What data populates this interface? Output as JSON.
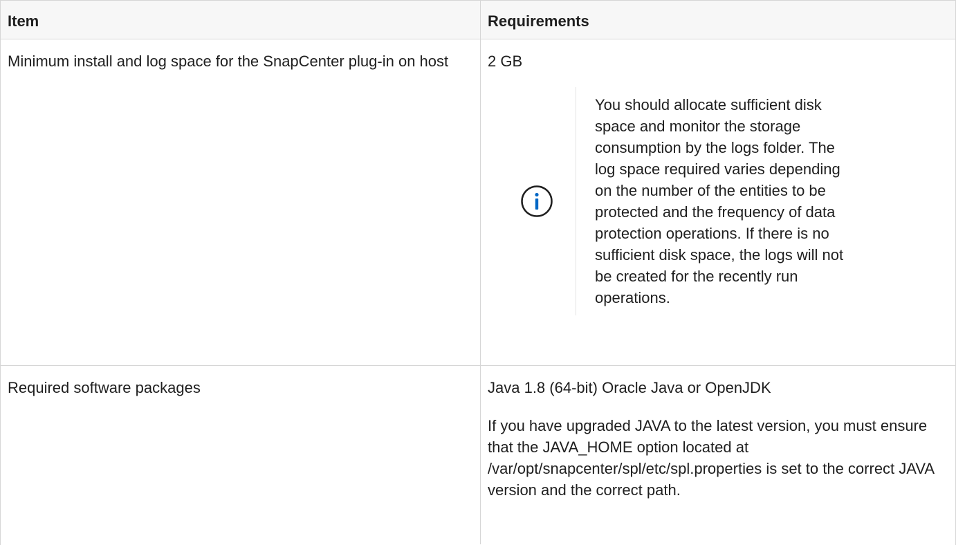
{
  "table": {
    "headers": {
      "item": "Item",
      "requirements": "Requirements"
    },
    "rows": [
      {
        "item": "Minimum install and log space for the SnapCenter plug-in on host",
        "requirement": "2 GB",
        "note": {
          "icon": "info-icon",
          "text": "You should allocate sufficient disk space and monitor the storage consumption by the logs folder. The log space required varies depending on the number of the entities to be protected and the frequency of data protection operations. If there is no sufficient disk space, the logs will not be created for the recently run operations."
        }
      },
      {
        "item": "Required software packages",
        "requirement": "Java 1.8 (64-bit) Oracle Java or OpenJDK",
        "detail": "If you have upgraded JAVA to the latest version, you must ensure that the JAVA_HOME option located at /var/opt/snapcenter/spl/etc/spl.properties is set to the correct JAVA version and the correct path."
      }
    ]
  },
  "colors": {
    "info_icon": "#0067c5",
    "border": "#d6d6d6",
    "header_bg": "#f7f7f7"
  }
}
